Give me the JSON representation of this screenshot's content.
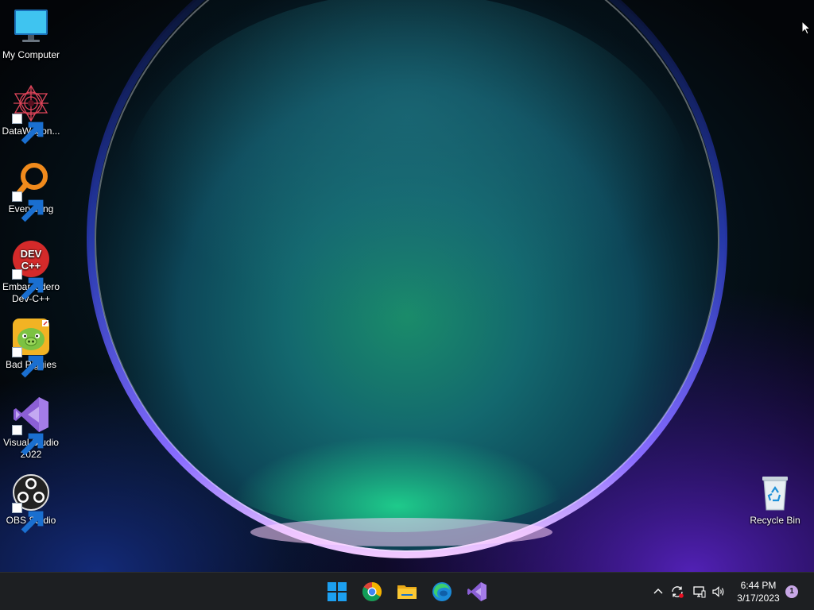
{
  "desktop": {
    "icons": [
      {
        "label": "My Computer",
        "icon": "monitor-icon",
        "shortcut": false
      },
      {
        "label": "DataWagon...",
        "icon": "datawagon-icon",
        "shortcut": true
      },
      {
        "label": "Everything",
        "icon": "magnifier-icon",
        "shortcut": true
      },
      {
        "label": "Embarcadero Dev-C++",
        "icon": "devcpp-icon",
        "shortcut": true,
        "icon_text_1": "DEV",
        "icon_text_2": "C++"
      },
      {
        "label": "Bad Piggies",
        "icon": "bad-piggies-icon",
        "shortcut": true
      },
      {
        "label": "Visual Studio 2022",
        "icon": "visual-studio-icon",
        "shortcut": true
      },
      {
        "label": "OBS Studio",
        "icon": "obs-icon",
        "shortcut": true
      }
    ],
    "recycle_bin": {
      "label": "Recycle Bin",
      "icon": "recycle-bin-icon"
    }
  },
  "taskbar": {
    "apps": [
      {
        "name": "Start",
        "icon": "windows-start-icon"
      },
      {
        "name": "Google Chrome",
        "icon": "chrome-icon"
      },
      {
        "name": "File Explorer",
        "icon": "folder-icon"
      },
      {
        "name": "Microsoft Edge",
        "icon": "edge-icon"
      },
      {
        "name": "Visual Studio",
        "icon": "visual-studio-icon"
      }
    ],
    "tray": {
      "icons": [
        "chevron-up-icon",
        "sync-icon",
        "network-icon",
        "volume-icon"
      ],
      "time": "6:44 PM",
      "date": "3/17/2023",
      "notification_count": "1"
    }
  },
  "colors": {
    "taskbar": "#1d1f22",
    "start_blue": "#1c9ff0",
    "visual_studio_purple": "#8b5fd6",
    "notification_badge": "#c8a7e6"
  }
}
